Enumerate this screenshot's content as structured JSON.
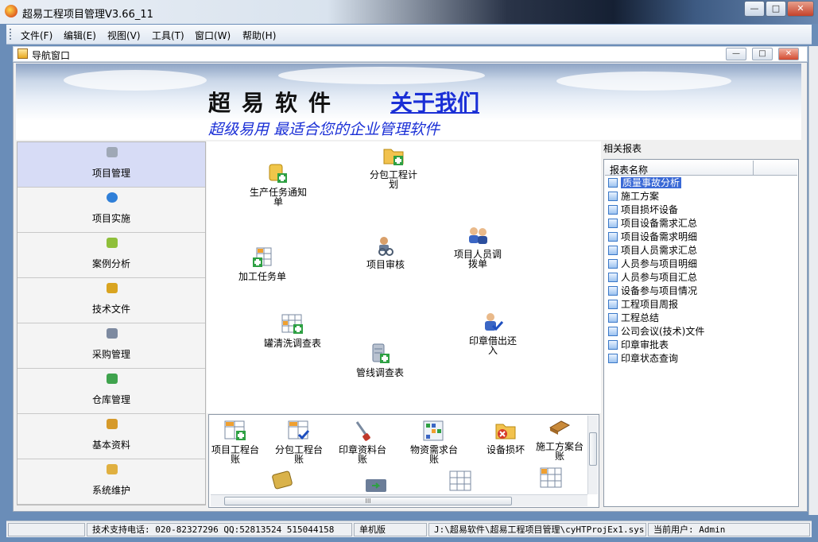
{
  "window": {
    "title": "超易工程项目管理V3.66_11",
    "min": "—",
    "max": "□",
    "close": "✕"
  },
  "menu": [
    "文件(F)",
    "编辑(E)",
    "视图(V)",
    "工具(T)",
    "窗口(W)",
    "帮助(H)"
  ],
  "child_window": {
    "title": "导航窗口",
    "min": "—",
    "max": "□",
    "close": "✕"
  },
  "banner": {
    "title": "超易软件",
    "about_link": "关于我们",
    "slogan": "超级易用  最适合您的企业管理软件"
  },
  "nav": {
    "items": [
      {
        "label": "项目管理",
        "icon": "truck-icon",
        "color": "#9fa8b6",
        "active": true
      },
      {
        "label": "项目实施",
        "icon": "database-icon",
        "color": "#2f7fd8"
      },
      {
        "label": "案例分析",
        "icon": "box-icon",
        "color": "#8fbf3a"
      },
      {
        "label": "技术文件",
        "icon": "keys-icon",
        "color": "#d9a420"
      },
      {
        "label": "采购管理",
        "icon": "printer-icon",
        "color": "#7d8aa0"
      },
      {
        "label": "仓库管理",
        "icon": "chart-icon",
        "color": "#3fa34d"
      },
      {
        "label": "基本资料",
        "icon": "document-icon",
        "color": "#d69a2a"
      },
      {
        "label": "系统维护",
        "icon": "hand-icon",
        "color": "#e0b040"
      }
    ]
  },
  "flow": {
    "items": [
      {
        "label": "生产任务通知单",
        "icon": "notice-add-icon"
      },
      {
        "label": "分包工程计划",
        "icon": "folder-add-icon"
      },
      {
        "label": "项目人员调拨单",
        "icon": "people-icon"
      },
      {
        "label": "项目审核",
        "icon": "review-icon"
      },
      {
        "label": "加工任务单",
        "icon": "grid-add-icon"
      },
      {
        "label": "罐清洗调查表",
        "icon": "table-add-icon"
      },
      {
        "label": "印章借出还入",
        "icon": "user-check-icon"
      },
      {
        "label": "管线调查表",
        "icon": "server-add-icon"
      }
    ]
  },
  "ledgers": {
    "items": [
      {
        "label": "项目工程台账",
        "icon": "ledger-add-icon"
      },
      {
        "label": "分包工程台账",
        "icon": "ledger-check-icon"
      },
      {
        "label": "印章资料台账",
        "icon": "stamp-icon"
      },
      {
        "label": "物资需求台账",
        "icon": "materials-grid-icon"
      },
      {
        "label": "设备损坏",
        "icon": "folder-remove-icon"
      },
      {
        "label": "施工方案台账",
        "icon": "book-icon"
      }
    ],
    "scroll_glyph": "III"
  },
  "reports": {
    "title": "相关报表",
    "column": "报表名称",
    "rows": [
      "质量事故分析",
      "施工方案",
      "项目损坏设备",
      "项目设备需求汇总",
      "项目设备需求明细",
      "项目人员需求汇总",
      "人员参与项目明细",
      "人员参与项目汇总",
      "设备参与项目情况",
      "工程项目周报",
      "工程总结",
      "公司会议(技术)文件",
      "印章审批表",
      "印章状态查询"
    ],
    "selected": "质量事故分析"
  },
  "status": {
    "support": "技术支持电话: 020-82327296 QQ:52813524 515044158",
    "edition": "单机版",
    "path": "J:\\超易软件\\超易工程项目管理\\cyHTProjEx1.sys",
    "user": "当前用户: Admin"
  }
}
